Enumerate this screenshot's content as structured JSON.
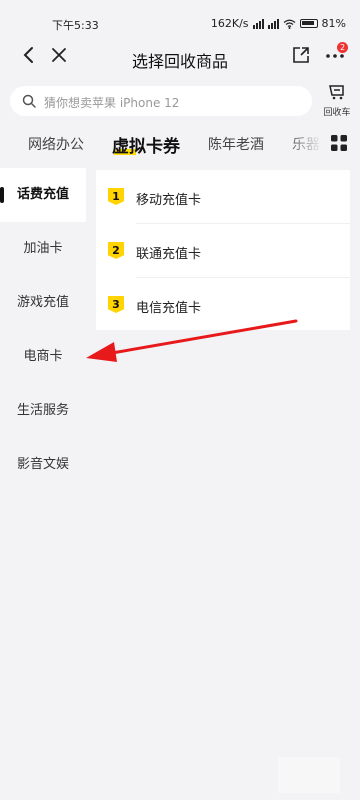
{
  "status_bar": {
    "time": "下午5:33",
    "speed": "162K/s",
    "battery": "81%"
  },
  "nav": {
    "title": "选择回收商品",
    "badge_count": "2"
  },
  "search": {
    "placeholder": "猜你想卖苹果 iPhone 12",
    "cart_label": "回收车"
  },
  "tabs": [
    {
      "label": "网络办公"
    },
    {
      "label": "虚拟卡券",
      "active": true
    },
    {
      "label": "陈年老酒"
    },
    {
      "label": "乐器"
    }
  ],
  "sidebar": {
    "items": [
      {
        "label": "话费充值",
        "active": true
      },
      {
        "label": "加油卡"
      },
      {
        "label": "游戏充值"
      },
      {
        "label": "电商卡"
      },
      {
        "label": "生活服务"
      },
      {
        "label": "影音文娱"
      }
    ]
  },
  "content": {
    "items": [
      {
        "number": "1",
        "label": "移动充值卡"
      },
      {
        "number": "2",
        "label": "联通充值卡"
      },
      {
        "number": "3",
        "label": "电信充值卡"
      }
    ]
  },
  "colors": {
    "accent": "#ffd400",
    "arrow": "#e8191b",
    "badge": "#ee3333"
  }
}
